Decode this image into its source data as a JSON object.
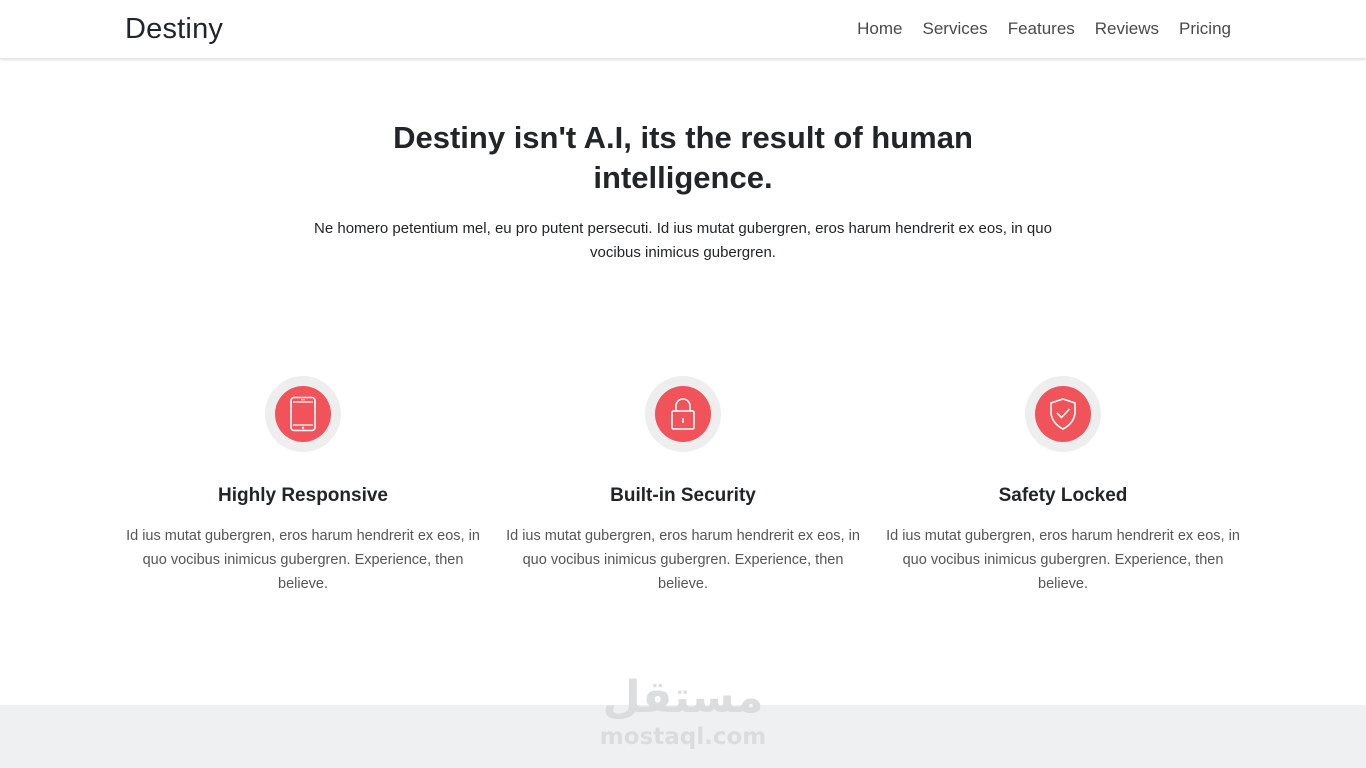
{
  "navbar": {
    "brand": "Destiny",
    "links": [
      "Home",
      "Services",
      "Features",
      "Reviews",
      "Pricing"
    ]
  },
  "hero": {
    "title": "Destiny isn't A.I, its the result of human intelligence.",
    "text": "Ne homero petentium mel, eu pro putent persecuti. Id ius mutat gubergren, eros harum hendrerit ex eos, in quo vocibus inimicus gubergren."
  },
  "features": [
    {
      "icon": "tablet-icon",
      "title": "Highly Responsive",
      "text": "Id ius mutat gubergren, eros harum hendrerit ex eos, in quo vocibus inimicus gubergren. Experience, then believe."
    },
    {
      "icon": "padlock-icon",
      "title": "Built-in Security",
      "text": "Id ius mutat gubergren, eros harum hendrerit ex eos, in quo vocibus inimicus gubergren. Experience, then believe."
    },
    {
      "icon": "shield-check-icon",
      "title": "Safety Locked",
      "text": "Id ius mutat gubergren, eros harum hendrerit ex eos, in quo vocibus inimicus gubergren. Experience, then believe."
    }
  ],
  "watermark": {
    "arabic": "مستقل",
    "latin": "mostaql.com"
  },
  "colors": {
    "accent": "#f0545a",
    "icon_ring": "#eeeeef",
    "footer_band": "#eff0f2"
  }
}
